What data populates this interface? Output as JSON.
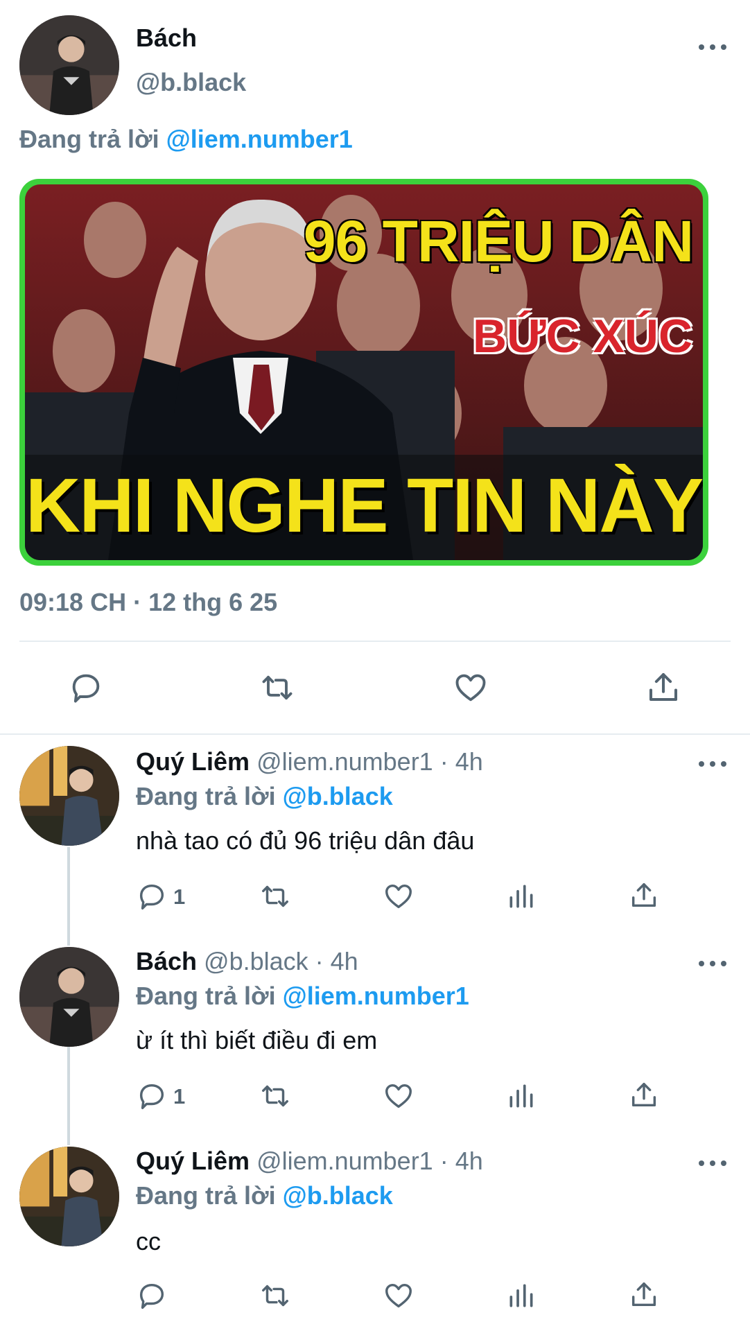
{
  "main_tweet": {
    "author_name": "Bách",
    "author_handle": "@b.black",
    "replying_prefix": "Đang trả lời",
    "replying_to": "@liem.number1",
    "image": {
      "line1": "96 TRIỆU DÂN",
      "line2": "BỨC XÚC",
      "line3": "KHI NGHE TIN NÀY"
    },
    "timestamp": "09:18 CH · 12 thg 6 25"
  },
  "replies": [
    {
      "author_name": "Quý Liêm",
      "author_handle": "@liem.number1",
      "time": "· 4h",
      "replying_prefix": "Đang trả lời",
      "replying_to": "@b.black",
      "text": "nhà tao có đủ 96 triệu dân đâu",
      "reply_count": "1"
    },
    {
      "author_name": "Bách",
      "author_handle": "@b.black",
      "time": "· 4h",
      "replying_prefix": "Đang trả lời",
      "replying_to": "@liem.number1",
      "text": "ừ ít thì biết điều đi em",
      "reply_count": "1"
    },
    {
      "author_name": "Quý Liêm",
      "author_handle": "@liem.number1",
      "time": "· 4h",
      "replying_prefix": "Đang trả lời",
      "replying_to": "@b.black",
      "text": "cc",
      "reply_count": ""
    }
  ],
  "colors": {
    "accent": "#1d9bf0",
    "secondary_text": "#657786",
    "image_border": "#3cd13c",
    "banner_yellow": "#f4e21a",
    "banner_red": "#d9242c"
  },
  "icons": [
    "comment-icon",
    "retweet-icon",
    "like-icon",
    "share-icon",
    "views-icon",
    "more-icon"
  ]
}
